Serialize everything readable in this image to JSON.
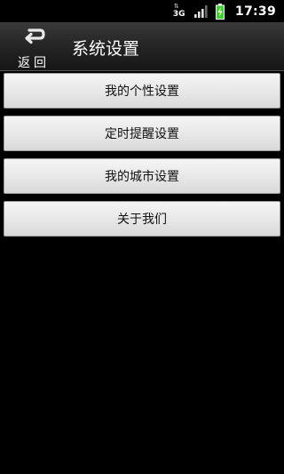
{
  "status_bar": {
    "network_type": "3G",
    "network_arrows": "⇅",
    "signal_icon": "signal-bars-icon",
    "battery_icon": "battery-charging-icon",
    "time": "17:39"
  },
  "header": {
    "back_label": "返回",
    "back_icon": "return-arrow-icon",
    "title": "系统设置"
  },
  "menu": {
    "items": [
      {
        "label": "我的个性设置"
      },
      {
        "label": "定时提醒设置"
      },
      {
        "label": "我的城市设置"
      },
      {
        "label": "关于我们"
      }
    ]
  },
  "colors": {
    "background": "#000000",
    "button_face": "#e8e8e8",
    "button_text": "#111111",
    "title_text": "#ffffff",
    "battery_bolt": "#3fcf2f"
  }
}
